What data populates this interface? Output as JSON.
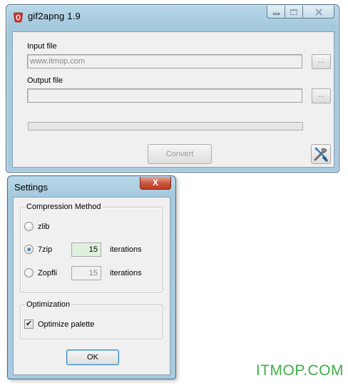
{
  "main_window": {
    "title": "gif2apng 1.9",
    "input_label": "Input file",
    "input_value": "www.itmop.com",
    "output_label": "Output file",
    "output_value": "",
    "browse_label": "...",
    "convert_label": "Convert",
    "progress_fraction": 0.0
  },
  "settings": {
    "title": "Settings",
    "close_label": "X",
    "compression_group": "Compression Method",
    "options": [
      {
        "label": "zlib",
        "selected": false
      },
      {
        "label": "7zip",
        "selected": true,
        "iterations": "15",
        "suffix": "iterations"
      },
      {
        "label": "Zopfli",
        "selected": false,
        "iterations": "15",
        "suffix": "iterations"
      }
    ],
    "optimization_group": "Optimization",
    "optimize_palette_label": "Optimize palette",
    "optimize_palette_checked": true,
    "ok_label": "OK"
  },
  "watermark": "ITMOP.COM",
  "colors": {
    "frame": "#a8cbe0",
    "close_red": "#c7543a",
    "watermark_green": "#3fae48",
    "active_field": "#dff0dd"
  },
  "icons": [
    "app-icon",
    "minimize-icon",
    "maximize-icon",
    "close-icon",
    "settings-tools-icon"
  ]
}
